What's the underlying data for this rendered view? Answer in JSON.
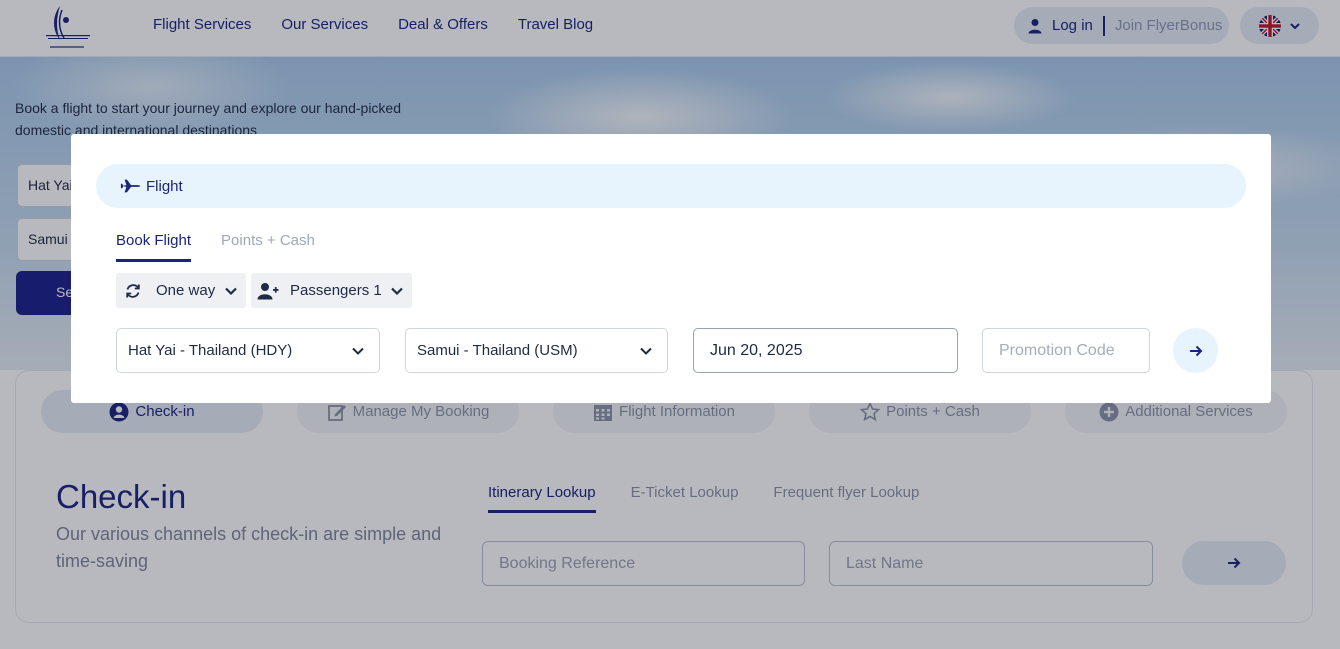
{
  "header": {
    "nav": [
      "Flight Services",
      "Our Services",
      "Deal & Offers",
      "Travel Blog"
    ],
    "login_label": "Log in",
    "join_label": "Join FlyerBonus",
    "language_icon": "uk-flag-icon"
  },
  "hero": {
    "text": "Book a flight to start your journey and explore our hand-picked domestic and international destinations",
    "origin_value": "Hat Yai",
    "destination_value": "Samui",
    "search_label": "Se"
  },
  "manage": {
    "tabs": [
      {
        "label": "Check-in",
        "icon": "user-circle-icon",
        "active": true
      },
      {
        "label": "Manage My Booking",
        "icon": "edit-icon",
        "active": false
      },
      {
        "label": "Flight Information",
        "icon": "calendar-grid-icon",
        "active": false
      },
      {
        "label": "Points + Cash",
        "icon": "star-icon",
        "active": false
      },
      {
        "label": "Additional Services",
        "icon": "plus-circle-icon",
        "active": false
      }
    ],
    "title": "Check-in",
    "subtitle": "Our various channels of check-in are simple and time-saving",
    "lookup_tabs": [
      "Itinerary Lookup",
      "E-Ticket Lookup",
      "Frequent flyer Lookup"
    ],
    "booking_ref_placeholder": "Booking Reference",
    "last_name_placeholder": "Last Name"
  },
  "modal": {
    "section_label": "Flight",
    "book_tabs": [
      "Book Flight",
      "Points + Cash"
    ],
    "trip_type": "One way",
    "passengers_label": "Passengers 1",
    "origin": "Hat Yai - Thailand (HDY)",
    "destination": "Samui - Thailand (USM)",
    "date": "Jun 20, 2025",
    "promo_placeholder": "Promotion Code"
  },
  "colors": {
    "brand_navy": "#1a237e",
    "pill_bg": "#e4ecf6",
    "flight_bar_bg": "#e7f4fd"
  }
}
